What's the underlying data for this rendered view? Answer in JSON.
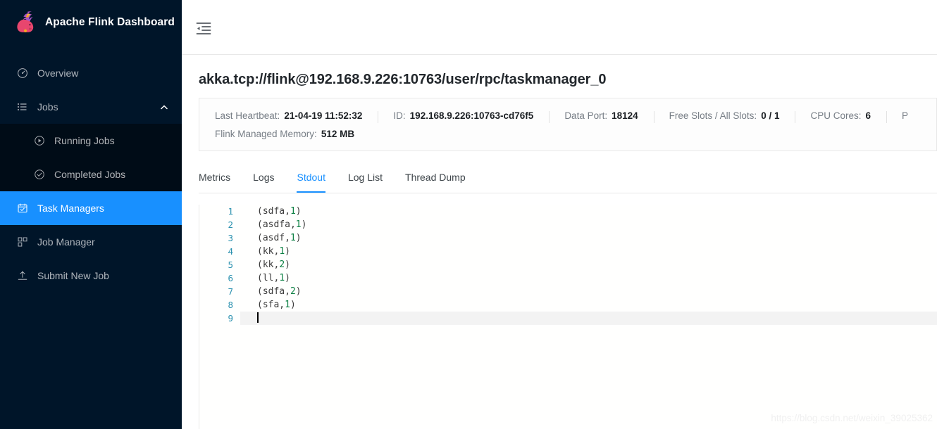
{
  "sidebar": {
    "brand": {
      "title": "Apache Flink Dashboard",
      "logo_icon": "flink-squirrel-logo"
    },
    "items": [
      {
        "label": "Overview",
        "icon": "dashboard-gauge-icon",
        "selected": false,
        "expandable": false
      },
      {
        "label": "Jobs",
        "icon": "unordered-list-icon",
        "selected": false,
        "expandable": true,
        "expanded": true
      },
      {
        "label": "Task Managers",
        "icon": "calendar-check-icon",
        "selected": true,
        "expandable": false
      },
      {
        "label": "Job Manager",
        "icon": "cluster-blocks-icon",
        "selected": false,
        "expandable": false
      },
      {
        "label": "Submit New Job",
        "icon": "upload-icon",
        "selected": false,
        "expandable": false
      }
    ],
    "submenu": [
      {
        "label": "Running Jobs",
        "icon": "play-circle-icon",
        "selected": false
      },
      {
        "label": "Completed Jobs",
        "icon": "check-circle-icon",
        "selected": false
      }
    ]
  },
  "topbar": {
    "fold_icon": "menu-fold-icon"
  },
  "page": {
    "title": "akka.tcp://flink@192.168.9.226:10763/user/rpc/taskmanager_0"
  },
  "infobar": {
    "row1": [
      {
        "label": "Last Heartbeat:",
        "value": "21-04-19 11:52:32"
      },
      {
        "label": "ID:",
        "value": "192.168.9.226:10763-cd76f5"
      },
      {
        "label": "Data Port:",
        "value": "18124"
      },
      {
        "label": "Free Slots / All Slots:",
        "value": "0 / 1"
      },
      {
        "label": "CPU Cores:",
        "value": "6"
      },
      {
        "label": "P",
        "value": ""
      }
    ],
    "row2": [
      {
        "label": "Flink Managed Memory:",
        "value": "512 MB"
      }
    ]
  },
  "tabs": [
    {
      "label": "Metrics",
      "active": false
    },
    {
      "label": "Logs",
      "active": false
    },
    {
      "label": "Stdout",
      "active": true
    },
    {
      "label": "Log List",
      "active": false
    },
    {
      "label": "Thread Dump",
      "active": false
    }
  ],
  "editor": {
    "lines": [
      {
        "num": "1",
        "word": "(sdfa,",
        "number": "1",
        "close": ")",
        "active": false
      },
      {
        "num": "2",
        "word": "(asdfa,",
        "number": "1",
        "close": ")",
        "active": false
      },
      {
        "num": "3",
        "word": "(asdf,",
        "number": "1",
        "close": ")",
        "active": false
      },
      {
        "num": "4",
        "word": "(kk,",
        "number": "1",
        "close": ")",
        "active": false
      },
      {
        "num": "5",
        "word": "(kk,",
        "number": "2",
        "close": ")",
        "active": false
      },
      {
        "num": "6",
        "word": "(ll,",
        "number": "1",
        "close": ")",
        "active": false
      },
      {
        "num": "7",
        "word": "(sdfa,",
        "number": "2",
        "close": ")",
        "active": false
      },
      {
        "num": "8",
        "word": "(sfa,",
        "number": "1",
        "close": ")",
        "active": false
      },
      {
        "num": "9",
        "word": "",
        "number": "",
        "close": "",
        "active": true
      }
    ]
  },
  "watermark": {
    "text": "https://blog.csdn.net/weixin_39025362"
  },
  "colors": {
    "sidebar_bg": "#001529",
    "submenu_bg": "#000c17",
    "accent": "#1890ff",
    "line_number": "#2b91af",
    "code_number": "#0b8043",
    "code_text": "#3b3b3b"
  }
}
